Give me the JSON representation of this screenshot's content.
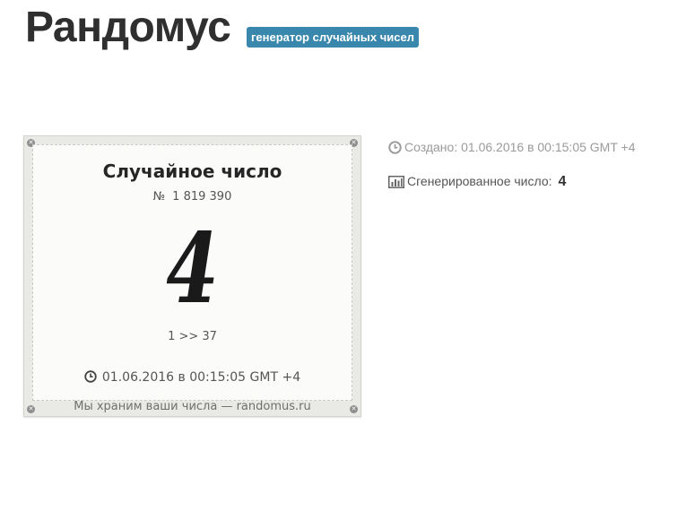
{
  "header": {
    "brand": "Рандомус",
    "badge": "генератор случайных чисел"
  },
  "card": {
    "title": "Случайное число",
    "number_prefix": "№",
    "number": "1 819 390",
    "result": "4",
    "range": "1 >> 37",
    "datetime": "01.06.2016 в 00:15:05 GMT +4",
    "footer": "Мы храним ваши числа — randomus.ru",
    "icon": "clock-icon"
  },
  "info": {
    "created_label": "Создано:",
    "created_value": "01.06.2016 в 00:15:05 GMT +4",
    "created_icon": "clock-icon",
    "generated_label": "Сгенерированное число:",
    "generated_value": "4",
    "generated_icon": "bar-chart-icon"
  },
  "colors": {
    "badge": "#3a87ad",
    "brand": "#2f2f2f",
    "muted": "#9a9a9a"
  }
}
